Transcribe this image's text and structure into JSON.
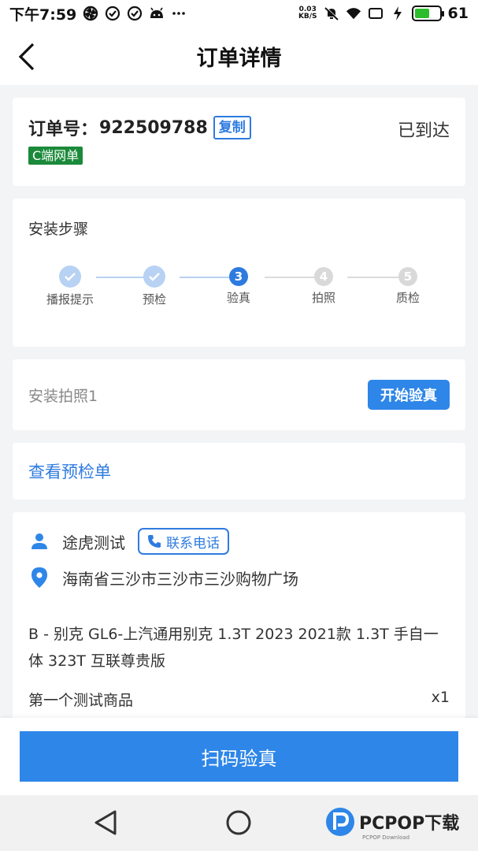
{
  "status_bar": {
    "time": "下午7:59",
    "speed_value": "0.03",
    "speed_unit": "KB/S",
    "battery": "61"
  },
  "header": {
    "title": "订单详情"
  },
  "order": {
    "label": "订单号：",
    "number": "922509788",
    "copy_label": "复制",
    "status": "已到达",
    "tag": "C端网单"
  },
  "steps": {
    "title": "安装步骤",
    "items": [
      {
        "label": "播报提示",
        "state": "done"
      },
      {
        "label": "预检",
        "state": "done"
      },
      {
        "label": "验真",
        "state": "current",
        "num": "3"
      },
      {
        "label": "拍照",
        "state": "pending",
        "num": "4"
      },
      {
        "label": "质检",
        "state": "pending",
        "num": "5"
      }
    ]
  },
  "photo": {
    "label": "安装拍照1",
    "button": "开始验真"
  },
  "precheck": {
    "link": "查看预检单"
  },
  "customer": {
    "name": "途虎测试",
    "call_label": "联系电话",
    "address": "海南省三沙市三沙市三沙购物广场",
    "car_model": "B - 别克 GL6-上汽通用别克 1.3T 2023 2021款 1.3T 手自一体 323T 互联尊贵版",
    "goods_name": "第一个测试商品",
    "goods_qty": "x1"
  },
  "bottom": {
    "scan_label": "扫码验真"
  },
  "watermark": {
    "brand": "PCPOP下载",
    "sub": "PCPOP Download"
  },
  "colors": {
    "accent": "#2e86e8",
    "tag_green": "#1a8a3a"
  }
}
